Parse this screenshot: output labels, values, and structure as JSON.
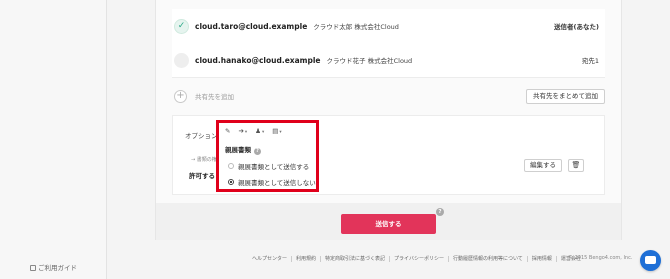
{
  "sidebar": {
    "guide_label": "ご利用ガイド"
  },
  "recipients": [
    {
      "email": "cloud.taro@cloud.example",
      "name_company": "クラウド太郎  株式会社Cloud",
      "role": "送信者(あなた)",
      "status": "done"
    },
    {
      "email": "cloud.hanako@cloud.example",
      "name_company": "クラウド花子  株式会社Cloud",
      "role": "宛先1",
      "status": "pending"
    }
  ],
  "add_recipient": {
    "label": "共有先を追加",
    "bulk_button": "共有先をまとめて追加"
  },
  "options": {
    "label": "オプション",
    "meta_label": "書類の権限",
    "permission": "許可する",
    "edit_button": "編集する",
    "trash_icon": "trash-icon"
  },
  "popup": {
    "tools": [
      "pen-icon",
      "arrow-icon",
      "stamp-icon",
      "document-icon"
    ],
    "title": "親展書類",
    "radio_options": [
      {
        "label": "親展書類として送信する",
        "selected": false
      },
      {
        "label": "親展書類として送信しない",
        "selected": true
      }
    ],
    "border_color": "#e0001b"
  },
  "send": {
    "label": "送信する",
    "color": "#e2345a"
  },
  "footer": {
    "links": [
      "ヘルプセンター",
      "利用規約",
      "特定商取引法に基づく表記",
      "プライバシーポリシー",
      "行動履歴情報の利用等について",
      "採用情報",
      "運営会社"
    ],
    "copyright": "© 2015 Bengo4.com, Inc."
  }
}
